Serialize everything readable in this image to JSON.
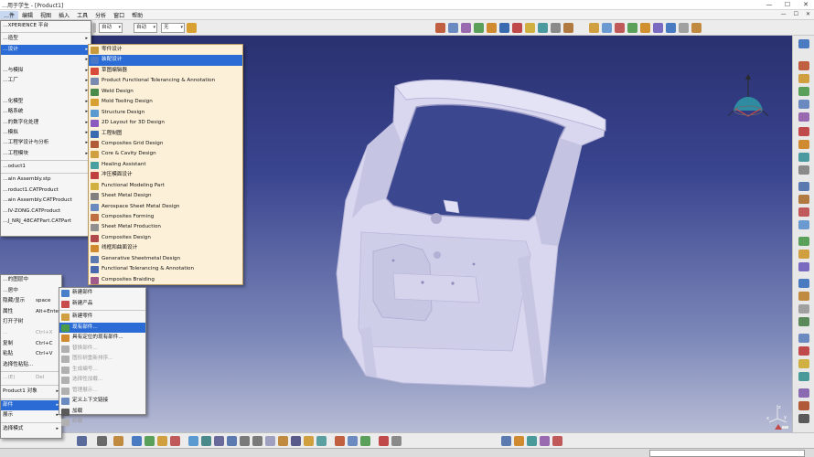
{
  "window": {
    "title": "…用于学生 - [Product1]",
    "buttons": [
      "—",
      "☐",
      "✕"
    ]
  },
  "menubar": {
    "items": [
      "…件",
      "编辑",
      "视图",
      "插入",
      "工具",
      "分析",
      "窗口",
      "帮助"
    ],
    "highlighted_index": 0,
    "right_buttons": [
      "—",
      "☐",
      "✕"
    ]
  },
  "toolbar": {
    "combo1": "自动",
    "combo2": "自动",
    "combo3": "无"
  },
  "start_menu": {
    "items": [
      {
        "label": "…XPERIENCE 平台",
        "sub": false
      },
      {
        "label": "…造型",
        "sub": true
      },
      {
        "label": "…设计",
        "sub": true,
        "highlighted": true
      },
      {
        "label": "",
        "sub": true
      },
      {
        "label": "…与模拟",
        "sub": true
      },
      {
        "label": "…工厂",
        "sub": true
      },
      {
        "label": "",
        "sub": true
      },
      {
        "label": "…化模型",
        "sub": true
      },
      {
        "label": "…略系统",
        "sub": true
      },
      {
        "label": "…的数字化处理",
        "sub": true
      },
      {
        "label": "…模拟",
        "sub": true
      },
      {
        "label": "…工程学设计与分析",
        "sub": true
      },
      {
        "label": "…工程模块",
        "sub": true
      },
      {
        "label": "",
        "sub": false
      },
      {
        "label": "…oduct1",
        "sub": false
      },
      {
        "label": "",
        "sub": false
      },
      {
        "label": "…ain Assembly.stp",
        "sub": false
      },
      {
        "label": "…roduct1.CATProduct",
        "sub": false
      },
      {
        "label": "…ain Assembly.CATProduct",
        "sub": false
      },
      {
        "label": "…IV-ZONG.CATProduct",
        "sub": false
      },
      {
        "label": "…J_NRJ_48CATPart.CATPart",
        "sub": false
      }
    ]
  },
  "workbench_menu": {
    "items": [
      {
        "label": "零件设计",
        "icon_color": "#c89a3c"
      },
      {
        "label": "装配设计",
        "icon_color": "#4a78c8",
        "highlighted": true
      },
      {
        "label": "草图编辑器",
        "icon_color": "#d84a3a"
      },
      {
        "label": "Product Functional Tolerancing & Annotation",
        "icon_color": "#7a8ab0"
      },
      {
        "label": "Weld Design",
        "icon_color": "#4a8a4a"
      },
      {
        "label": "Mold Tooling Design",
        "icon_color": "#d8a030"
      },
      {
        "label": "Structure Design",
        "icon_color": "#5a9ad0"
      },
      {
        "label": "2D Layout for 3D Design",
        "icon_color": "#8a5ac0"
      },
      {
        "label": "工程制图",
        "icon_color": "#3a6ab0"
      },
      {
        "label": "Composites Grid Design",
        "icon_color": "#b05a3a"
      },
      {
        "label": "Core & Cavity Design",
        "icon_color": "#d0a040"
      },
      {
        "label": "Healing Assistant",
        "icon_color": "#4aa0a0"
      },
      {
        "label": "冲压模面设计",
        "icon_color": "#c04040"
      },
      {
        "label": "Functional Modeling Part",
        "icon_color": "#d0b040"
      },
      {
        "label": "Sheet Metal Design",
        "icon_color": "#808080"
      },
      {
        "label": "Aerospace Sheet Metal  Design",
        "icon_color": "#6a8ac0"
      },
      {
        "label": "Composites Forming",
        "icon_color": "#c07040"
      },
      {
        "label": "Sheet Metal Production",
        "icon_color": "#909090"
      },
      {
        "label": "Composites Design",
        "icon_color": "#b04a4a"
      },
      {
        "label": "线框和曲面设计",
        "icon_color": "#d08a30"
      },
      {
        "label": "Generative Sheetmetal Design",
        "icon_color": "#5a7ab0"
      },
      {
        "label": "Functional Tolerancing & Annotation",
        "icon_color": "#4a6ab0"
      },
      {
        "label": "Composites Braiding",
        "icon_color": "#a05a8a"
      }
    ]
  },
  "context_menu": {
    "items": [
      {
        "label": "…的图层中",
        "shortcut": "",
        "sub": false
      },
      {
        "label": "…居中",
        "shortcut": "",
        "sub": false
      },
      {
        "label": "隐藏/显示",
        "shortcut": "space",
        "sub": false
      },
      {
        "label": "属性",
        "shortcut": "Alt+Enter",
        "sub": false
      },
      {
        "label": "打开子树",
        "shortcut": "",
        "sub": false
      },
      {
        "label": "…",
        "shortcut": "Ctrl+X",
        "sub": false,
        "disabled": true
      },
      {
        "label": "复制",
        "shortcut": "Ctrl+C",
        "sub": false
      },
      {
        "label": "粘贴",
        "shortcut": "Ctrl+V",
        "sub": false
      },
      {
        "label": "选择性粘贴...",
        "shortcut": "",
        "sub": false
      },
      {
        "label": "",
        "shortcut": "",
        "sub": false
      },
      {
        "label": "…(E)",
        "shortcut": "Del",
        "sub": false,
        "disabled": true
      },
      {
        "label": "",
        "shortcut": "",
        "sub": false
      },
      {
        "label": "Product1 对象",
        "shortcut": "",
        "sub": true
      },
      {
        "label": "",
        "shortcut": "",
        "sub": false
      },
      {
        "label": "部件",
        "shortcut": "",
        "sub": true,
        "highlighted": true
      },
      {
        "label": "展示",
        "shortcut": "",
        "sub": true
      },
      {
        "label": "",
        "shortcut": "",
        "sub": false
      },
      {
        "label": "选择模式",
        "shortcut": "",
        "sub": true
      }
    ]
  },
  "components_submenu": {
    "items": [
      {
        "label": "新建部件",
        "icon_color": "#4a80c8"
      },
      {
        "label": "新建产品",
        "icon_color": "#c84a4a"
      },
      {
        "label": "",
        "icon_color": ""
      },
      {
        "label": "新建零件",
        "icon_color": "#d0a040"
      },
      {
        "label": "现有部件...",
        "icon_color": "#4a9a4a",
        "highlighted": true
      },
      {
        "label": "具有定位的现有部件...",
        "icon_color": "#d08a30"
      },
      {
        "label": "替换部件...",
        "icon_color": "#b0b0b0",
        "disabled": true
      },
      {
        "label": "图形树重新排序...",
        "icon_color": "#b0b0b0",
        "disabled": true
      },
      {
        "label": "生成编号...",
        "icon_color": "#b0b0b0",
        "disabled": true
      },
      {
        "label": "选择性加载...",
        "icon_color": "#b0b0b0",
        "disabled": true
      },
      {
        "label": "管理展示...",
        "icon_color": "#b0b0b0",
        "disabled": true
      },
      {
        "label": "定义上下文链接",
        "icon_color": "#6a8ac0"
      },
      {
        "label": "加载",
        "icon_color": "#5a5a5a"
      },
      {
        "label": "卸载",
        "icon_color": "#b0b0b0",
        "disabled": true
      }
    ]
  },
  "viewport": {
    "bg_top": "#2a3170",
    "bg_bottom": "#b7bcd5",
    "part_color": "#d8d7ef"
  },
  "axes": {
    "x": "x",
    "y": "y",
    "z": "z"
  }
}
